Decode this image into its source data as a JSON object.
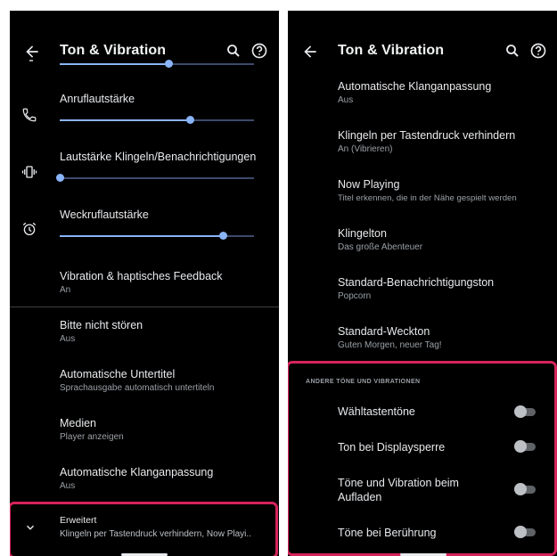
{
  "left": {
    "title": "Ton & Vibration",
    "rows": {
      "call_volume": "Anruflautstärke",
      "ring_volume": "Lautstärke Klingeln/Benachrichtigungen",
      "alarm_volume": "Weckruflautstärke",
      "vibration_title": "Vibration & haptisches Feedback",
      "vibration_sub": "An",
      "dnd_title": "Bitte nicht stören",
      "dnd_sub": "Aus",
      "captions_title": "Automatische Untertitel",
      "captions_sub": "Sprachausgabe automatisch untertiteln",
      "media_title": "Medien",
      "media_sub": "Player anzeigen",
      "adaptive_title": "Automatische Klanganpassung",
      "adaptive_sub": "Aus",
      "advanced_title": "Erweitert",
      "advanced_sub": "Klingeln per Tastendruck verhindern, Now Playi.."
    },
    "sliders": {
      "media_level": 0.56,
      "call_level": 0.67,
      "ring_level": 0.0,
      "alarm_level": 0.84
    }
  },
  "right": {
    "title": "Ton & Vibration",
    "rows": [
      {
        "title": "Automatische Klanganpassung",
        "sub": "Aus"
      },
      {
        "title": "Klingeln per Tastendruck verhindern",
        "sub": "An (Vibrieren)"
      },
      {
        "title": "Now Playing",
        "sub": "Titel erkennen, die in der Nähe gespielt werden"
      },
      {
        "title": "Klingelton",
        "sub": "Das große Abenteuer"
      },
      {
        "title": "Standard-Benachrichtigungston",
        "sub": "Popcorn"
      },
      {
        "title": "Standard-Weckton",
        "sub": "Guten Morgen, neuer Tag!"
      }
    ],
    "section_header": "ANDERE TÖNE UND VIBRATIONEN",
    "toggles": [
      {
        "label": "Wähltastentöne",
        "on": false
      },
      {
        "label": "Ton bei Displaysperre",
        "on": false
      },
      {
        "label_line1": "Töne und Vibration beim",
        "label_line2": "Aufladen",
        "on": false
      },
      {
        "label": "Töne bei Berührung",
        "on": false
      }
    ]
  },
  "colors": {
    "background": "#000000",
    "accent": "#8ab4f8",
    "highlight": "#d6245b",
    "secondary_text": "#9aa0a6"
  },
  "icons": [
    "back-arrow-icon",
    "search-icon",
    "help-icon",
    "phone-icon",
    "vibrate-icon",
    "alarm-icon",
    "chevron-down-icon"
  ]
}
